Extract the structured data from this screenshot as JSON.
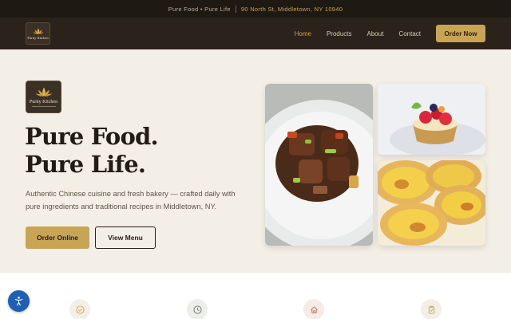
{
  "topbar": {
    "tagline": "Pure Food • Pure Life",
    "address": "90 North St, Middletown, NY 10940"
  },
  "brand": {
    "logo_text": "Purity Kitchen",
    "logo_icon": "lotus-icon"
  },
  "nav": {
    "links": [
      {
        "label": "Home",
        "active": true
      },
      {
        "label": "Products",
        "active": false
      },
      {
        "label": "About",
        "active": false
      },
      {
        "label": "Contact",
        "active": false
      }
    ],
    "cta_label": "Order Now"
  },
  "hero": {
    "headline_line1": "Pure Food.",
    "headline_line2": "Pure Life.",
    "subtext": "Authentic Chinese cuisine and fresh bakery — crafted daily with pure ingredients and traditional recipes in Middletown, NY.",
    "primary_button": "Order Online",
    "secondary_button": "View Menu"
  },
  "features": {
    "icons": [
      "check-circle-icon",
      "clock-icon",
      "home-icon",
      "clipboard-icon"
    ]
  },
  "accessibility": {
    "icon": "accessibility-icon"
  },
  "colors": {
    "accent_gold": "#c8a455",
    "dark_brown": "#2b231b",
    "cream": "#f4efe6",
    "a11y_blue": "#1d5fb4"
  }
}
